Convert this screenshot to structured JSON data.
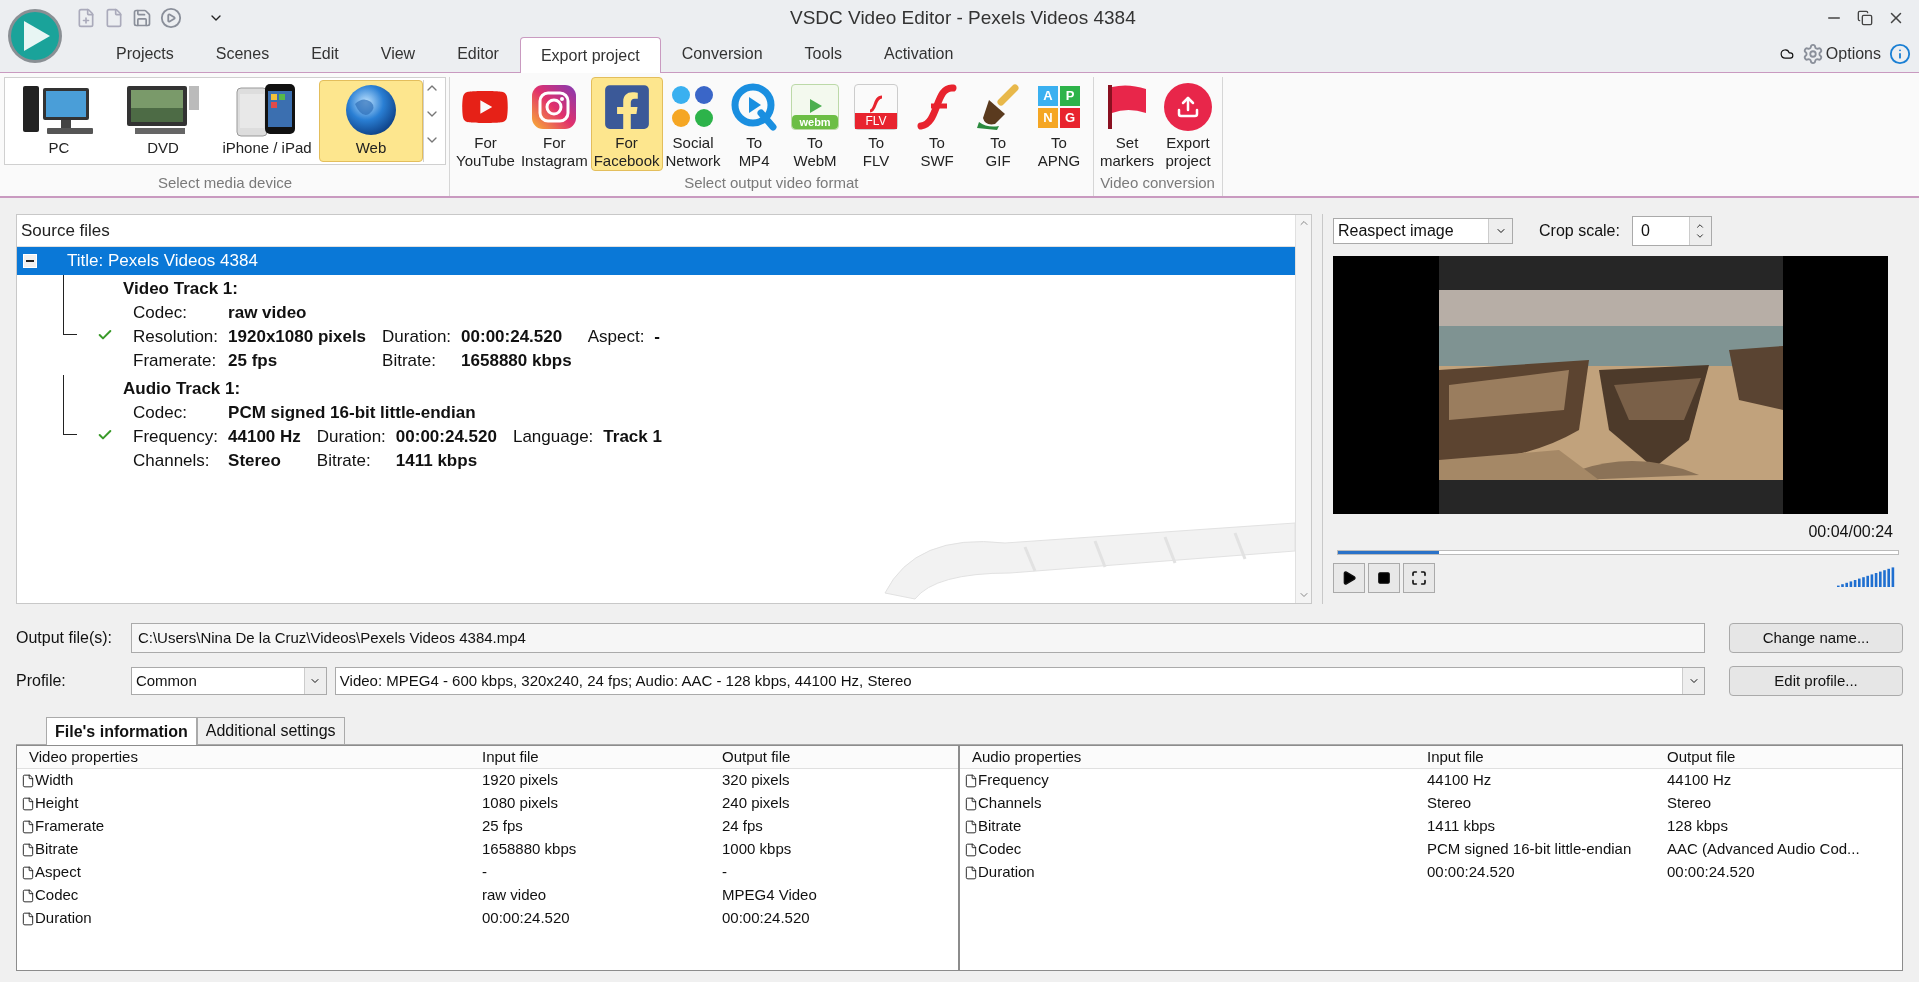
{
  "window": {
    "title": "VSDC Video Editor - Pexels Videos 4384"
  },
  "options_button": {
    "label": "Options"
  },
  "menu_tabs": [
    {
      "label": "Projects",
      "selected": false
    },
    {
      "label": "Scenes",
      "selected": false
    },
    {
      "label": "Edit",
      "selected": false
    },
    {
      "label": "View",
      "selected": false
    },
    {
      "label": "Editor",
      "selected": false
    },
    {
      "label": "Export project",
      "selected": true
    },
    {
      "label": "Conversion",
      "selected": false
    },
    {
      "label": "Tools",
      "selected": false
    },
    {
      "label": "Activation",
      "selected": false
    }
  ],
  "ribbon": {
    "groups": [
      {
        "caption": "Select media device",
        "scroll": true,
        "items": [
          {
            "label": "PC",
            "kind": "pc",
            "selected": false
          },
          {
            "label": "DVD",
            "kind": "dvd",
            "selected": false
          },
          {
            "label": "iPhone / iPad",
            "kind": "phone",
            "selected": false
          },
          {
            "label": "Web",
            "kind": "globe",
            "selected": true
          }
        ]
      },
      {
        "caption": "Select output video format",
        "scroll": false,
        "items": [
          {
            "label": "For\nYouTube",
            "kind": "youtube",
            "selected": false
          },
          {
            "label": "For\nInstagram",
            "kind": "instagram",
            "selected": false
          },
          {
            "label": "For\nFacebook",
            "kind": "facebook",
            "selected": true
          },
          {
            "label": "Social\nNetwork",
            "kind": "social",
            "selected": false
          },
          {
            "label": "To\nMP4",
            "kind": "mp4",
            "selected": false
          },
          {
            "label": "To\nWebM",
            "kind": "webm",
            "icon_text": "webm",
            "selected": false
          },
          {
            "label": "To\nFLV",
            "kind": "flv",
            "icon_text": "FLV",
            "selected": false
          },
          {
            "label": "To\nSWF",
            "kind": "swf",
            "selected": false
          },
          {
            "label": "To\nGIF",
            "kind": "gif",
            "selected": false
          },
          {
            "label": "To\nAPNG",
            "kind": "apng",
            "icon_letters": [
              "A",
              "P",
              "N",
              "G"
            ],
            "selected": false
          }
        ]
      },
      {
        "caption": "Video conversion",
        "scroll": false,
        "items": [
          {
            "label": "Set\nmarkers",
            "kind": "flag",
            "selected": false
          },
          {
            "label": "Export\nproject",
            "kind": "export",
            "selected": false
          }
        ]
      }
    ]
  },
  "source_files": {
    "header": "Source files",
    "title": "Title: Pexels Videos 4384",
    "selected": true,
    "expanded": true,
    "tracks": [
      {
        "heading": "Video Track 1:",
        "checked": true,
        "codec": {
          "label": "Codec:",
          "value": "raw video"
        },
        "fields": [
          [
            {
              "label": "Resolution:",
              "value": "1920x1080 pixels"
            },
            {
              "label": "Duration:",
              "value": "00:00:24.520"
            },
            {
              "label": "Aspect:",
              "value": "-"
            }
          ],
          [
            {
              "label": "Framerate:",
              "value": "25 fps"
            },
            {
              "label": "Bitrate:",
              "value": "1658880 kbps"
            }
          ]
        ]
      },
      {
        "heading": "Audio Track 1:",
        "checked": true,
        "codec": {
          "label": "Codec:",
          "value": "PCM signed 16-bit little-endian"
        },
        "fields": [
          [
            {
              "label": "Frequency:",
              "value": "44100 Hz"
            },
            {
              "label": "Duration:",
              "value": "00:00:24.520"
            },
            {
              "label": "Language:",
              "value": "Track 1"
            }
          ],
          [
            {
              "label": "Channels:",
              "value": "Stereo"
            },
            {
              "label": "Bitrate:",
              "value": "1411 kbps"
            }
          ]
        ]
      }
    ]
  },
  "preview": {
    "mode": "Reaspect image",
    "crop_label": "Crop scale:",
    "crop_value": "0",
    "time": "00:04/00:24",
    "progress": {
      "level": 0.18
    }
  },
  "output": {
    "label": "Output file(s):",
    "value": "C:\\Users\\Nina De la Cruz\\Videos\\Pexels Videos 4384.mp4",
    "button": "Change name..."
  },
  "profile": {
    "label": "Profile:",
    "preset": "Common",
    "description": "Video: MPEG4 - 600 kbps, 320x240, 24 fps; Audio: AAC - 128 kbps, 44100 Hz, Stereo",
    "button": "Edit profile..."
  },
  "info_tabs": [
    {
      "label": "File's information",
      "selected": true
    },
    {
      "label": "Additional settings",
      "selected": false
    }
  ],
  "tables": [
    {
      "columns": [
        "Video properties",
        "Input file",
        "Output file"
      ],
      "rows": [
        [
          "Width",
          "1920 pixels",
          "320 pixels"
        ],
        [
          "Height",
          "1080 pixels",
          "240 pixels"
        ],
        [
          "Framerate",
          "25 fps",
          "24 fps"
        ],
        [
          "Bitrate",
          "1658880 kbps",
          "1000 kbps"
        ],
        [
          "Aspect",
          "-",
          "-"
        ],
        [
          "Codec",
          "raw video",
          "MPEG4 Video"
        ],
        [
          "Duration",
          "00:00:24.520",
          "00:00:24.520"
        ]
      ]
    },
    {
      "columns": [
        "Audio properties",
        "Input file",
        "Output file"
      ],
      "rows": [
        [
          "Frequency",
          "44100 Hz",
          "44100 Hz"
        ],
        [
          "Channels",
          "Stereo",
          "Stereo"
        ],
        [
          "Bitrate",
          "1411 kbps",
          "128 kbps"
        ],
        [
          "Codec",
          "PCM signed 16-bit little-endian",
          "AAC (Advanced Audio Cod..."
        ],
        [
          "Duration",
          "00:00:24.520",
          "00:00:24.520"
        ]
      ]
    }
  ]
}
